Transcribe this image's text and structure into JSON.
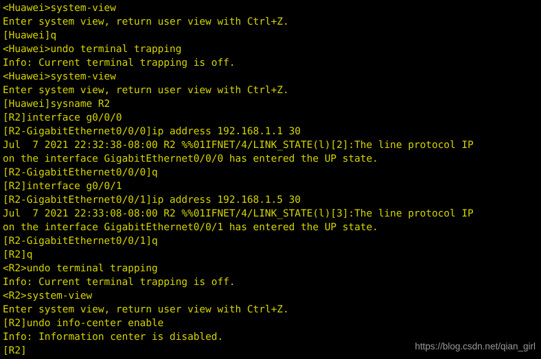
{
  "terminal": {
    "background_color": "#000000",
    "text_color": "#d5d500",
    "lines": [
      "<Huawei>system-view",
      "Enter system view, return user view with Ctrl+Z.",
      "[Huawei]q",
      "<Huawei>undo terminal trapping",
      "Info: Current terminal trapping is off.",
      "<Huawei>system-view",
      "Enter system view, return user view with Ctrl+Z.",
      "[Huawei]sysname R2",
      "[R2]interface g0/0/0",
      "[R2-GigabitEthernet0/0/0]ip address 192.168.1.1 30",
      "Jul  7 2021 22:32:38-08:00 R2 %%01IFNET/4/LINK_STATE(l)[2]:The line protocol IP",
      "on the interface GigabitEthernet0/0/0 has entered the UP state.",
      "[R2-GigabitEthernet0/0/0]q",
      "[R2]interface g0/0/1",
      "[R2-GigabitEthernet0/0/1]ip address 192.168.1.5 30",
      "Jul  7 2021 22:33:08-08:00 R2 %%01IFNET/4/LINK_STATE(l)[3]:The line protocol IP",
      "on the interface GigabitEthernet0/0/1 has entered the UP state.",
      "[R2-GigabitEthernet0/0/1]q",
      "[R2]q",
      "<R2>undo terminal trapping",
      "Info: Current terminal trapping is off.",
      "<R2>system-view",
      "Enter system view, return user view with Ctrl+Z.",
      "[R2]undo info-center enable",
      "Info: Information center is disabled.",
      "[R2]"
    ]
  },
  "watermark": {
    "text": "https://blog.csdn.net/qian_girl",
    "color": "#9a9a9a"
  }
}
